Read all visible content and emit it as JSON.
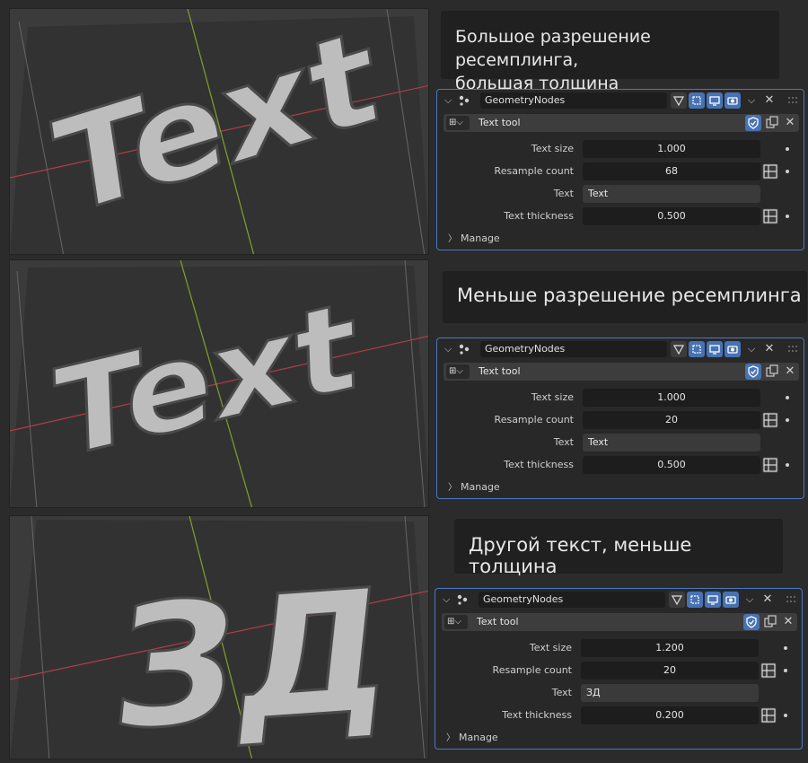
{
  "captions": [
    {
      "line1": "Большое разрешение ресемплинга,",
      "line2": "большая толщина"
    },
    {
      "line1": "Меньше разрешение ресемплинга"
    },
    {
      "line1": "Другой текст, меньше толщина"
    }
  ],
  "panels": [
    {
      "modifier_name": "GeometryNodes",
      "tool_name": "Text tool",
      "props": [
        {
          "label": "Text size",
          "value": "1.000"
        },
        {
          "label": "Resample count",
          "value": "68"
        },
        {
          "label": "Text",
          "value": "Text"
        },
        {
          "label": "Text thickness",
          "value": "0.500"
        }
      ],
      "manage_label": "Manage"
    },
    {
      "modifier_name": "GeometryNodes",
      "tool_name": "Text tool",
      "props": [
        {
          "label": "Text size",
          "value": "1.000"
        },
        {
          "label": "Resample count",
          "value": "20"
        },
        {
          "label": "Text",
          "value": "Text"
        },
        {
          "label": "Text thickness",
          "value": "0.500"
        }
      ],
      "manage_label": "Manage"
    },
    {
      "modifier_name": "GeometryNodes",
      "tool_name": "Text tool",
      "props": [
        {
          "label": "Text size",
          "value": "1.200"
        },
        {
          "label": "Resample count",
          "value": "20"
        },
        {
          "label": "Text",
          "value": "ЗД"
        },
        {
          "label": "Text thickness",
          "value": "0.200"
        }
      ],
      "manage_label": "Manage"
    }
  ],
  "viewport_texts": [
    "Text",
    "Text",
    "ЗД"
  ],
  "colors": {
    "accent": "#4772b3",
    "panel_border": "#4a78c2",
    "x_axis": "#b33b4b",
    "y_axis": "#7fa32a",
    "mesh": "#bdbdbd"
  }
}
